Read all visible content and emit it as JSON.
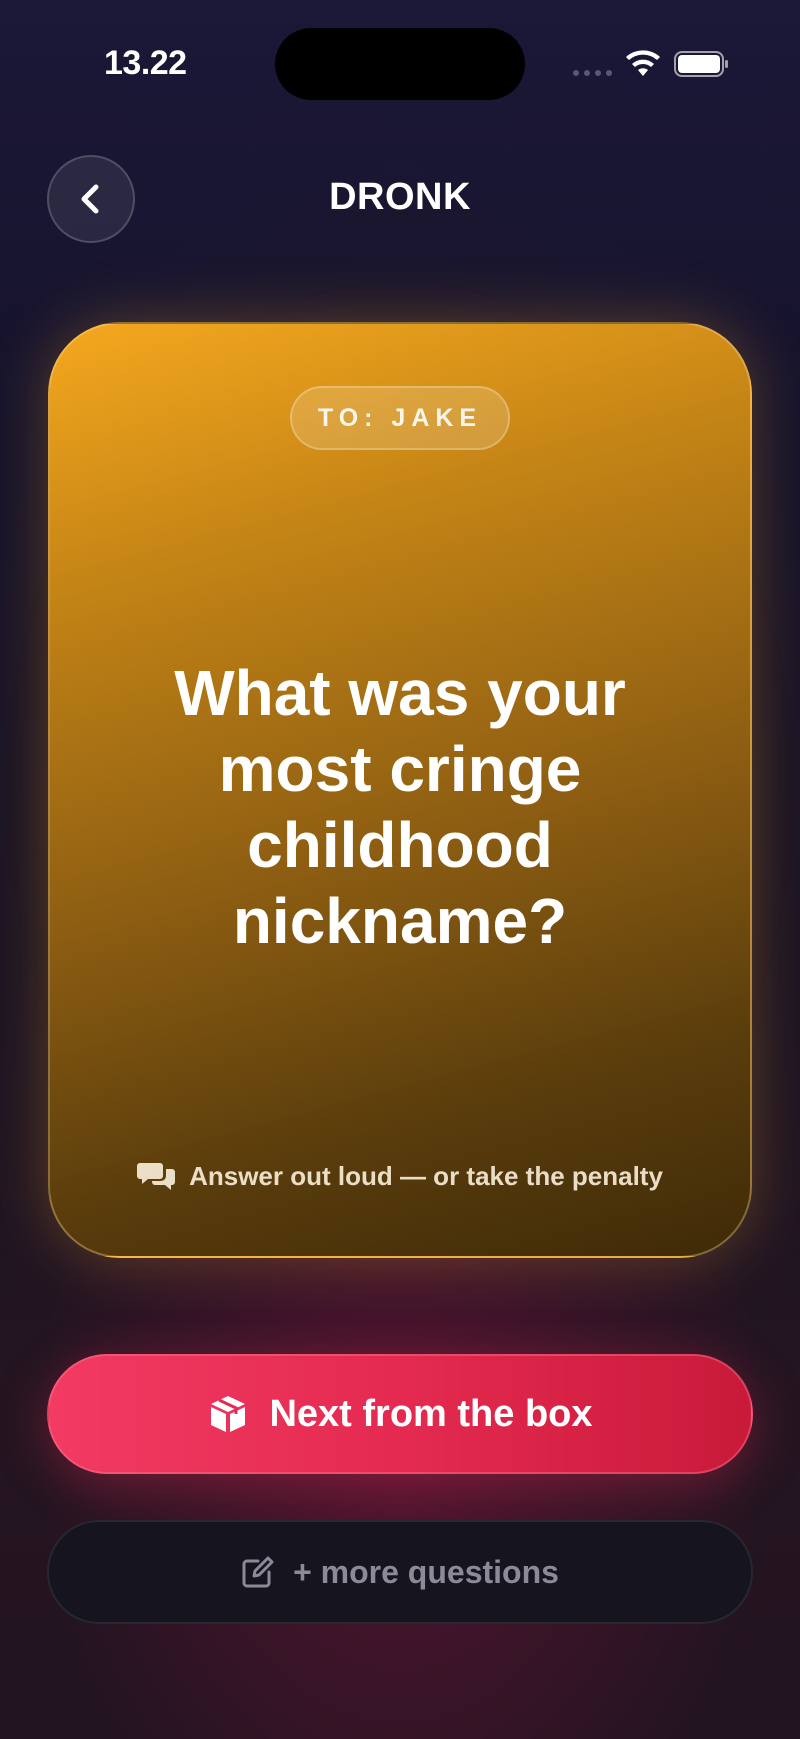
{
  "status_bar": {
    "time": "13.22"
  },
  "header": {
    "title": "DRONK",
    "back_icon": "chevron-left-icon"
  },
  "card": {
    "recipient": "TO: JAKE",
    "question": "What was your most cringe childhood nickname?",
    "hint": "Answer out loud — or take the penalty",
    "hint_icon": "chat-bubbles-icon",
    "accent": "#f5a81f"
  },
  "actions": {
    "next_label": "Next from the box",
    "next_icon": "cube-icon",
    "next_color": "#e42a50",
    "more_label": "+ more questions",
    "more_icon": "edit-icon"
  }
}
